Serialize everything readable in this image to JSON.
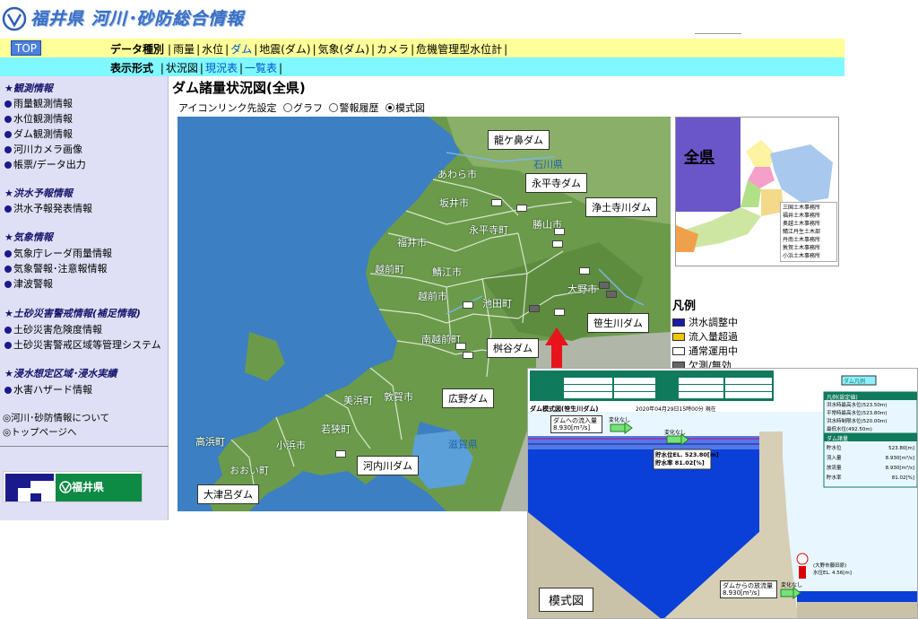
{
  "header": {
    "site_title": "福井県 河川･砂防総合情報"
  },
  "nav1": {
    "top_label": "TOP",
    "head": "データ種別",
    "items": [
      {
        "label": "雨量"
      },
      {
        "label": "水位"
      },
      {
        "label": "ダム",
        "active": true
      },
      {
        "label": "地震(ダム)"
      },
      {
        "label": "気象(ダム)"
      },
      {
        "label": "カメラ"
      },
      {
        "label": "危機管理型水位計"
      }
    ]
  },
  "nav2": {
    "head": "表示形式",
    "items": [
      {
        "label": "状況図"
      },
      {
        "label": "現況表"
      },
      {
        "label": "一覧表"
      }
    ]
  },
  "sidebar": {
    "sections": [
      {
        "title": "★観測情報",
        "items": [
          "雨量観測情報",
          "水位観測情報",
          "ダム観測情報",
          "河川カメラ画像",
          "帳票/データ出力"
        ]
      },
      {
        "title": "★洪水予報情報",
        "items": [
          "洪水予報発表情報"
        ]
      },
      {
        "title": "★気象情報",
        "items": [
          "気象庁レーダ雨量情報",
          "気象警報･注意報情報",
          "津波警報"
        ]
      },
      {
        "title": "★土砂災害警戒情報(補足情報)",
        "items": [
          "土砂災害危険度情報",
          "土砂災害警戒区域等管理システム"
        ]
      },
      {
        "title": "★浸水想定区域･浸水実績",
        "items": [
          "水害ハザード情報"
        ]
      }
    ],
    "links": [
      "◎河川･砂防情報について",
      "◎トップページへ"
    ],
    "pref_logo": "福井県"
  },
  "main": {
    "title": "ダム諸量状況図(全県)",
    "icon_link": {
      "label": "アイコンリンク先設定",
      "options": [
        {
          "label": "グラフ",
          "checked": false
        },
        {
          "label": "警報履歴",
          "checked": false
        },
        {
          "label": "模式図",
          "checked": true
        }
      ]
    }
  },
  "map": {
    "dam_labels": [
      "龍ケ鼻ダム",
      "永平寺ダム",
      "浄土寺川ダム",
      "笹生川ダム",
      "桝谷ダム",
      "広野ダム",
      "河内川ダム",
      "大津呂ダム"
    ],
    "cities": [
      "あわら市",
      "坂井市",
      "永平寺町",
      "勝山市",
      "福井市",
      "鯖江市",
      "越前町",
      "越前市",
      "大野市",
      "池田町",
      "南越前町",
      "美浜町",
      "敦賀市",
      "若狭町",
      "高浜町",
      "小浜市",
      "おおい町"
    ],
    "seas": [
      "石川県",
      "滋賀県"
    ]
  },
  "mini_map": {
    "label": "全県",
    "offices": [
      "三国土木事務所",
      "福井土木事務所",
      "奥越土木事務所",
      "鯖江丹生土木部",
      "丹南土木事務所",
      "敦賀土木事務所",
      "小浜土木事務所"
    ]
  },
  "legend": {
    "title": "凡例",
    "items": [
      {
        "label": "洪水調整中",
        "color": "#1a1aa8"
      },
      {
        "label": "流入量超過",
        "color": "#f2c500"
      },
      {
        "label": "通常運用中",
        "color": "#ffffff"
      },
      {
        "label": "欠測/無効",
        "color": "#666666"
      }
    ]
  },
  "schema": {
    "caption": "模式図",
    "subtitle": "ダム模式図(笹生川ダム)",
    "date": "2020年04月29日15時00分 現在",
    "inflow_title": "ダムへの流入量",
    "inflow_value": "8.930[m³/s]",
    "outflow_title": "ダムからの放流量",
    "outflow_value": "8.930[m³/s]",
    "level_line1": "貯水位EL.  523.80[m]",
    "level_line2": "貯水率    81.02[%]",
    "change1": "変化なし",
    "change2": "変化なし",
    "change3": "変化なし",
    "legend_button": "ダム凡例",
    "levels_title": "凡例(設定値)",
    "levels": [
      "洪水時最高水位(523.50m)",
      "平常時最高水位(523.80m)",
      "洪水時制限水位(520.00m)",
      "最低水位(492.50m)"
    ],
    "amounts_title": "ダム諸量",
    "amounts": [
      {
        "k": "貯水位",
        "v": "523.80[m]"
      },
      {
        "k": "流入量",
        "v": "8.930[m³/s]"
      },
      {
        "k": "放流量",
        "v": "8.930[m³/s]"
      },
      {
        "k": "貯水率",
        "v": "81.02[%]"
      }
    ],
    "downstream_name": "(大野市藤田原)",
    "downstream_level": "水位EL.  4.56[m]"
  },
  "colors": {
    "nav1_bg": "#ffff99",
    "nav2_bg": "#7ff8ff",
    "sidebar_bg": "#dfe0f5",
    "land": "#6b9b4a",
    "sea": "#3c7fc2",
    "arrow": "#e8141c",
    "water": "#0a3fd8"
  }
}
